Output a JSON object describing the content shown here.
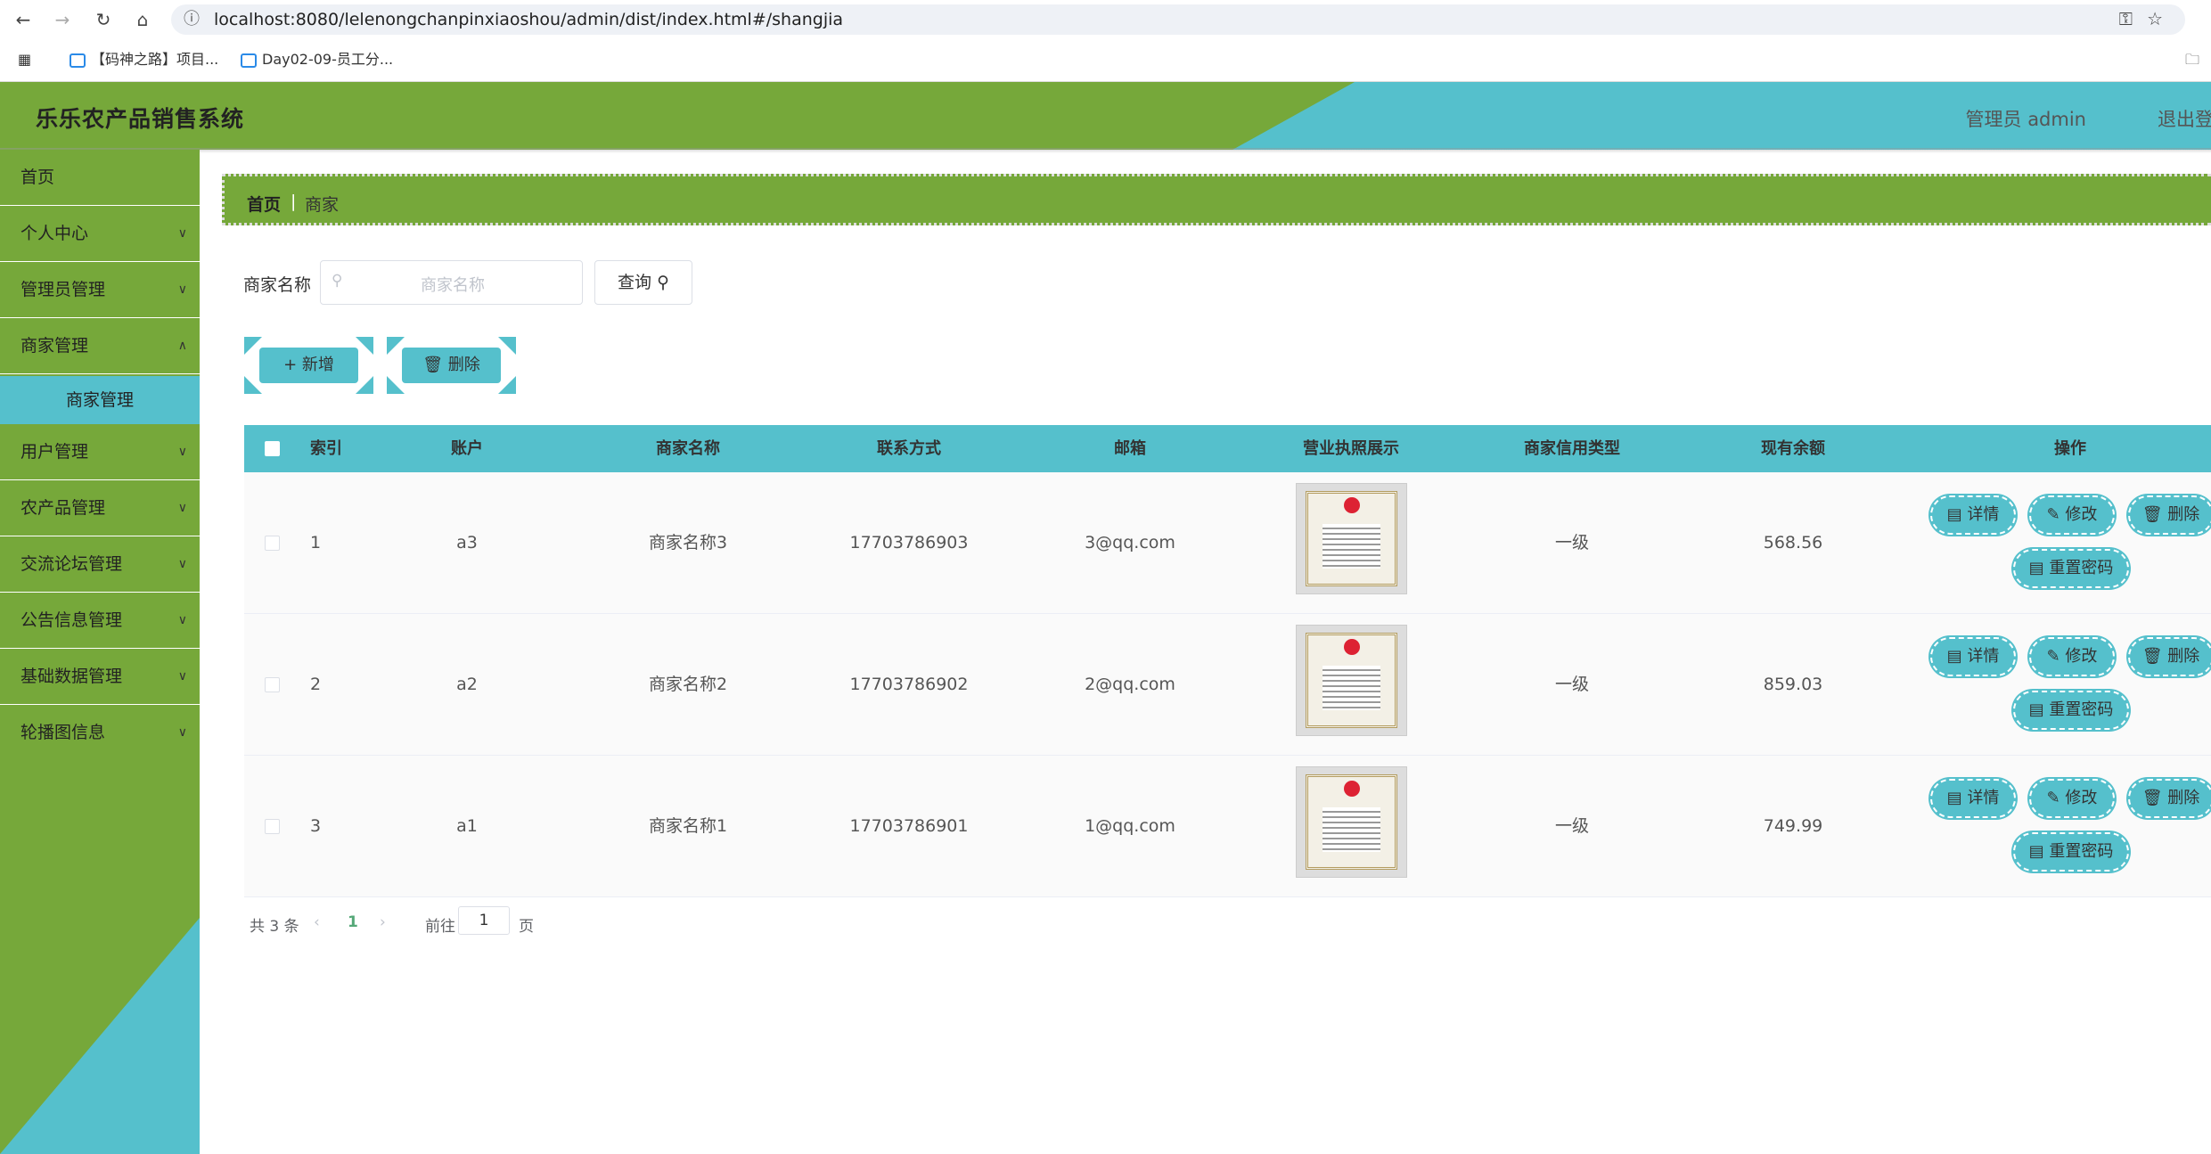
{
  "browser": {
    "url": "localhost:8080/lelenongchanpinxiaoshou/admin/dist/index.html#/shangjia",
    "bookmarks": [
      "【码神之路】项目...",
      "Day02-09-员工分..."
    ]
  },
  "header": {
    "title": "乐乐农产品销售系统",
    "user": "管理员 admin",
    "logout": "退出登"
  },
  "sidebar": {
    "items": [
      {
        "label": "首页"
      },
      {
        "label": "个人中心"
      },
      {
        "label": "管理员管理"
      },
      {
        "label": "商家管理"
      },
      {
        "label": "商家管理"
      },
      {
        "label": "用户管理"
      },
      {
        "label": "农产品管理"
      },
      {
        "label": "交流论坛管理"
      },
      {
        "label": "公告信息管理"
      },
      {
        "label": "基础数据管理"
      },
      {
        "label": "轮播图信息"
      }
    ]
  },
  "breadcrumb": {
    "home": "首页",
    "sep": "|",
    "current": "商家"
  },
  "search": {
    "label": "商家名称",
    "placeholder": "商家名称",
    "button": "查询"
  },
  "actions": {
    "add": "新增",
    "delete": "删除"
  },
  "table": {
    "headers": [
      "索引",
      "账户",
      "商家名称",
      "联系方式",
      "邮箱",
      "营业执照展示",
      "商家信用类型",
      "现有余额",
      "操作"
    ],
    "rows": [
      {
        "index": "1",
        "account": "a3",
        "name": "商家名称3",
        "phone": "17703786903",
        "email": "3@qq.com",
        "credit": "一级",
        "balance": "568.56"
      },
      {
        "index": "2",
        "account": "a2",
        "name": "商家名称2",
        "phone": "17703786902",
        "email": "2@qq.com",
        "credit": "一级",
        "balance": "859.03"
      },
      {
        "index": "3",
        "account": "a1",
        "name": "商家名称1",
        "phone": "17703786901",
        "email": "1@qq.com",
        "credit": "一级",
        "balance": "749.99"
      }
    ],
    "ops": {
      "detail": "详情",
      "edit": "修改",
      "delete": "删除",
      "reset": "重置密码"
    }
  },
  "pagination": {
    "total": "共 3 条",
    "current": "1",
    "goto": "前往",
    "page_value": "1",
    "page_suffix": "页"
  },
  "colors": {
    "green": "#76a83a",
    "teal": "#55c0cc"
  }
}
